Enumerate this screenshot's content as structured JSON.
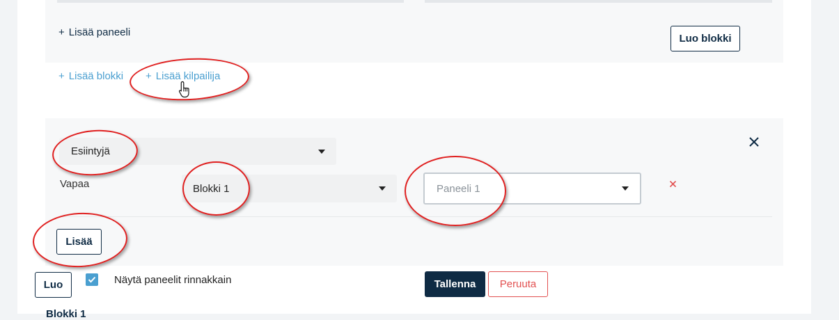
{
  "top_panel": {
    "add_panel_label": "Lisää paneeli",
    "create_block_label": "Luo blokki"
  },
  "add_links": {
    "add_block_label": "Lisää blokki",
    "add_competitor_label": "Lisää kilpailija"
  },
  "competitor_form": {
    "performer_select_value": "Esiintyjä",
    "free_label": "Vapaa",
    "block_select_value": "Blokki 1",
    "panel_select_placeholder": "Paneeli 1",
    "add_button_label": "Lisää"
  },
  "footer": {
    "create_button_label": "Luo",
    "side_by_side_checkbox_checked": true,
    "side_by_side_label": "Näytä paneelit rinnakkain",
    "save_button_label": "Tallenna",
    "cancel_button_label": "Peruuta",
    "next_heading": "Blokki 1"
  },
  "colors": {
    "dark_navy": "#0f2b44",
    "link_blue": "#4a9fd0",
    "danger_red": "#e25050",
    "annotation_red": "#e02020"
  },
  "icons": {
    "plus": "+",
    "close": "×",
    "remove": "×"
  }
}
